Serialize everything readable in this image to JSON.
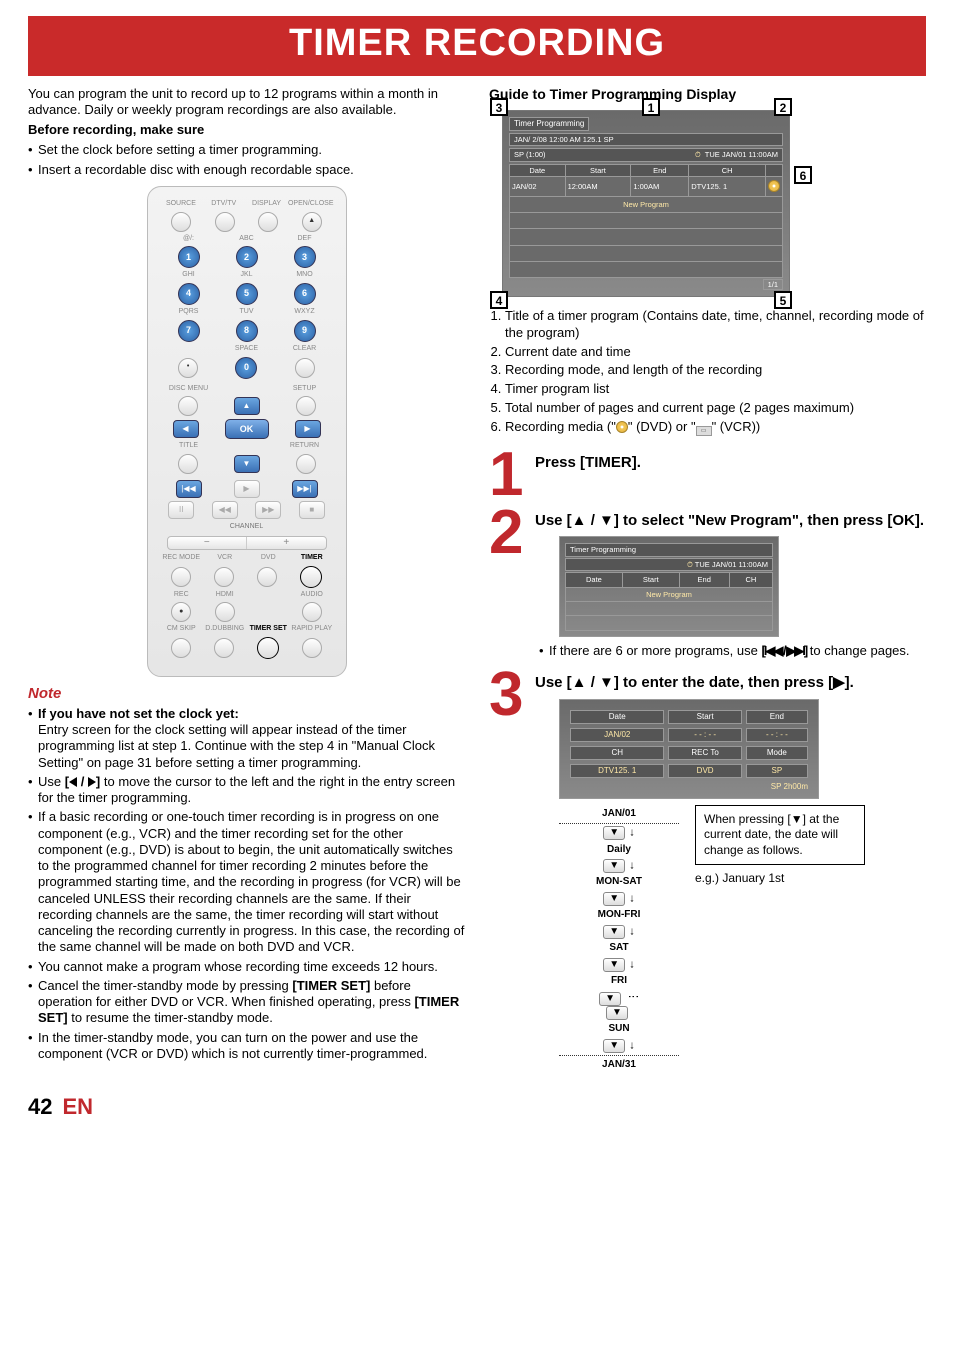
{
  "header": {
    "title": "TIMER RECORDING"
  },
  "left": {
    "intro": "You can program the unit to record up to 12 programs within a month in advance. Daily or weekly program recordings are also available.",
    "before_hdr": "Before recording, make sure",
    "before": [
      "Set the clock before setting a timer programming.",
      "Insert a recordable disc with enough recordable space."
    ],
    "note_hdr": "Note",
    "note_b": "If you have not set the clock yet:",
    "note_p1": "Entry screen for the clock setting will appear instead of the timer programming list at step 1. Continue with the step 4 in \"Manual Clock Setting\" on page 31 before setting a timer programming.",
    "note2a": "Use ",
    "note2b": " to move the cursor to the left and the right in the entry screen for the timer programming.",
    "note3": "If a basic recording or one-touch timer recording is in progress on one component (e.g., VCR) and the timer recording set for the other component (e.g., DVD) is about to begin, the unit automatically switches to the programmed channel for timer recording 2 minutes before the programmed starting time, and the recording in progress (for VCR) will be canceled UNLESS their recording channels are the same. If their recording channels are the same, the timer recording will start without canceling the recording currently in progress. In this case, the recording of the same channel will be made on both DVD and VCR.",
    "note4": "You cannot make a program whose recording time exceeds 12 hours.",
    "note5a": "Cancel the timer-standby mode by pressing ",
    "note5b": "[TIMER SET]",
    "note5c": " before operation for either DVD or VCR. When finished operating, press ",
    "note5d": "[TIMER SET]",
    "note5e": " to resume the timer-standby mode.",
    "note6": "In the timer-standby mode, you can turn on the power and use the component (VCR or DVD) which is not currently timer-programmed."
  },
  "remote": {
    "toprow": [
      "SOURCE",
      "DTV/TV",
      "DISPLAY",
      "OPEN/CLOSE"
    ],
    "keys": {
      "r1": [
        "@/:",
        "ABC",
        "DEF"
      ],
      "n1": [
        "1",
        "2",
        "3"
      ],
      "r2": [
        "GHI",
        "JKL",
        "MNO"
      ],
      "n2": [
        "4",
        "5",
        "6"
      ],
      "r3": [
        "PQRS",
        "TUV",
        "WXYZ"
      ],
      "n3": [
        "7",
        "8",
        "9"
      ],
      "r4": [
        "",
        "SPACE",
        "CLEAR"
      ],
      "n4": [
        "•",
        "0",
        ""
      ]
    },
    "discmenu": "DISC MENU",
    "setup": "SETUP",
    "ok": "OK",
    "title": "TITLE",
    "return": "RETURN",
    "channel": "CHANNEL",
    "minus": "−",
    "plus": "+",
    "bottom1": [
      "REC MODE",
      "VCR",
      "DVD",
      "TIMER"
    ],
    "bottom2": [
      "REC",
      "HDMI",
      "",
      "AUDIO"
    ],
    "bottom3": [
      "CM SKIP",
      "D.DUBBING",
      "TIMER SET",
      "RAPID PLAY"
    ]
  },
  "right": {
    "guide_hdr": "Guide to Timer Programming Display",
    "osd": {
      "title": "Timer Programming",
      "info": "JAN/  2/08  12:00 AM 125.1 SP",
      "mode": "SP  (1:00)",
      "now": "TUE JAN/01 11:00AM",
      "cols": [
        "Date",
        "Start",
        "End",
        "CH"
      ],
      "row": [
        "JAN/02",
        "12:00AM",
        "1:00AM",
        "DTV125. 1"
      ],
      "newprog": "New Program",
      "page": "1/1"
    },
    "legend": [
      "Title of a timer program (Contains date, time, channel, recording mode of the program)",
      "Current date and time",
      "Recording mode, and length of the recording",
      "Timer program list",
      "Total number of pages and current page (2 pages maximum)",
      "Recording media (\" DVD \" or \" VCR \")"
    ],
    "legend6_pre": "Recording media (\"",
    "legend6_mid": "\" (DVD) or \"",
    "legend6_end": "\" (VCR))",
    "step1": "Press [TIMER].",
    "step2_head": "Use [▲ / ▼] to select \"New Program\", then press [OK].",
    "step2_note_a": "If there are 6 or more programs, use ",
    "step2_note_b": " to change pages.",
    "step2_keys": "[|◀◀ / ▶▶|]",
    "miniosd": {
      "title": "Timer Programming",
      "now": "TUE JAN/01 11:00AM",
      "cols": [
        "Date",
        "Start",
        "End",
        "CH"
      ],
      "newprog": "New Program"
    },
    "step3_head": "Use [▲ / ▼] to enter the date, then press [▶].",
    "param": {
      "r1": [
        "Date",
        "Start",
        "End"
      ],
      "v1": [
        "JAN/02",
        "- - : - -",
        "- - : - -"
      ],
      "r2": [
        "CH",
        "REC To",
        "Mode"
      ],
      "v2": [
        "DTV125. 1",
        "DVD",
        "SP"
      ],
      "foot": "SP     2h00m"
    },
    "dateflow": {
      "first": "JAN/01",
      "items": [
        "Daily",
        "MON-SAT",
        "MON-FRI",
        "SAT",
        "FRI",
        "SUN"
      ],
      "last": "JAN/31",
      "boxnote": "When pressing [▼] at the current date, the date will change as follows.",
      "eg": "e.g.) January 1st"
    }
  },
  "footer": {
    "page": "42",
    "lang": "EN"
  }
}
